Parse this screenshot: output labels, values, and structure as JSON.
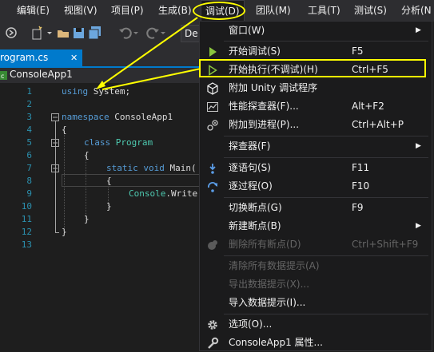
{
  "menubar": {
    "items": [
      {
        "label": "编辑(E)"
      },
      {
        "label": "视图(V)"
      },
      {
        "label": "项目(P)"
      },
      {
        "label": "生成(B)"
      },
      {
        "label": "调试(D)"
      },
      {
        "label": "团队(M)"
      },
      {
        "label": "工具(T)"
      },
      {
        "label": "测试(S)"
      },
      {
        "label": "分析(N"
      }
    ]
  },
  "toolbar": {
    "config_label": "De"
  },
  "tab": {
    "label": "rogram.cs",
    "close": "✕"
  },
  "navbar": {
    "project": "ConsoleApp1"
  },
  "editor": {
    "line_numbers": [
      "1",
      "2",
      "3",
      "4",
      "5",
      "6",
      "7",
      "8",
      "9",
      "10",
      "11",
      "12",
      "13"
    ],
    "lines": [
      {
        "kw": "using",
        "rest": " System;"
      },
      {
        "kw": "",
        "rest": ""
      },
      {
        "kw": "namespace",
        "rest": " ConsoleApp1"
      },
      {
        "kw": "",
        "rest": "{"
      },
      {
        "kw": "class",
        "type": " Program",
        "rest": ""
      },
      {
        "kw": "",
        "rest": "{"
      },
      {
        "kw": "static void",
        "rest": " Main("
      },
      {
        "kw": "",
        "rest": "{"
      },
      {
        "kw": "",
        "type": "Console",
        "rest": ".Write"
      },
      {
        "kw": "",
        "rest": "}"
      },
      {
        "kw": "",
        "rest": "}"
      },
      {
        "kw": "",
        "rest": "}"
      },
      {
        "kw": "",
        "rest": ""
      }
    ]
  },
  "debug_menu": {
    "items": [
      {
        "label": "窗口(W)",
        "shortcut": "",
        "submenu": true,
        "icon": "",
        "disabled": false
      },
      {
        "label": "开始调试(S)",
        "shortcut": "F5",
        "submenu": false,
        "icon": "play-icon",
        "disabled": false
      },
      {
        "label": "开始执行(不调试)(H)",
        "shortcut": "Ctrl+F5",
        "submenu": false,
        "icon": "play-outline-icon",
        "disabled": false
      },
      {
        "label": "附加 Unity 调试程序",
        "shortcut": "",
        "submenu": false,
        "icon": "unity-cube-icon",
        "disabled": false
      },
      {
        "label": "性能探查器(F)...",
        "shortcut": "Alt+F2",
        "submenu": false,
        "icon": "profiler-icon",
        "disabled": false
      },
      {
        "label": "附加到进程(P)...",
        "shortcut": "Ctrl+Alt+P",
        "submenu": false,
        "icon": "attach-process-icon",
        "disabled": false
      },
      {
        "label": "探查器(F)",
        "shortcut": "",
        "submenu": true,
        "icon": "",
        "disabled": false
      },
      {
        "label": "逐语句(S)",
        "shortcut": "F11",
        "submenu": false,
        "icon": "step-into-icon",
        "disabled": false
      },
      {
        "label": "逐过程(O)",
        "shortcut": "F10",
        "submenu": false,
        "icon": "step-over-icon",
        "disabled": false
      },
      {
        "label": "切换断点(G)",
        "shortcut": "F9",
        "submenu": false,
        "icon": "",
        "disabled": false
      },
      {
        "label": "新建断点(B)",
        "shortcut": "",
        "submenu": true,
        "icon": "",
        "disabled": false
      },
      {
        "label": "删除所有断点(D)",
        "shortcut": "Ctrl+Shift+F9",
        "submenu": false,
        "icon": "delete-breakpoints-icon",
        "disabled": true
      },
      {
        "label": "清除所有数据提示(A)",
        "shortcut": "",
        "submenu": false,
        "icon": "",
        "disabled": true
      },
      {
        "label": "导出数据提示(X)...",
        "shortcut": "",
        "submenu": false,
        "icon": "",
        "disabled": true
      },
      {
        "label": "导入数据提示(I)...",
        "shortcut": "",
        "submenu": false,
        "icon": "",
        "disabled": false
      },
      {
        "label": "选项(O)...",
        "shortcut": "",
        "submenu": false,
        "icon": "gear-icon",
        "disabled": false
      },
      {
        "label": "ConsoleApp1 属性...",
        "shortcut": "",
        "submenu": false,
        "icon": "wrench-icon",
        "disabled": false
      }
    ]
  },
  "colors": {
    "accent": "#007acc",
    "annotation": "#ffff00",
    "play": "#8ac53e"
  }
}
